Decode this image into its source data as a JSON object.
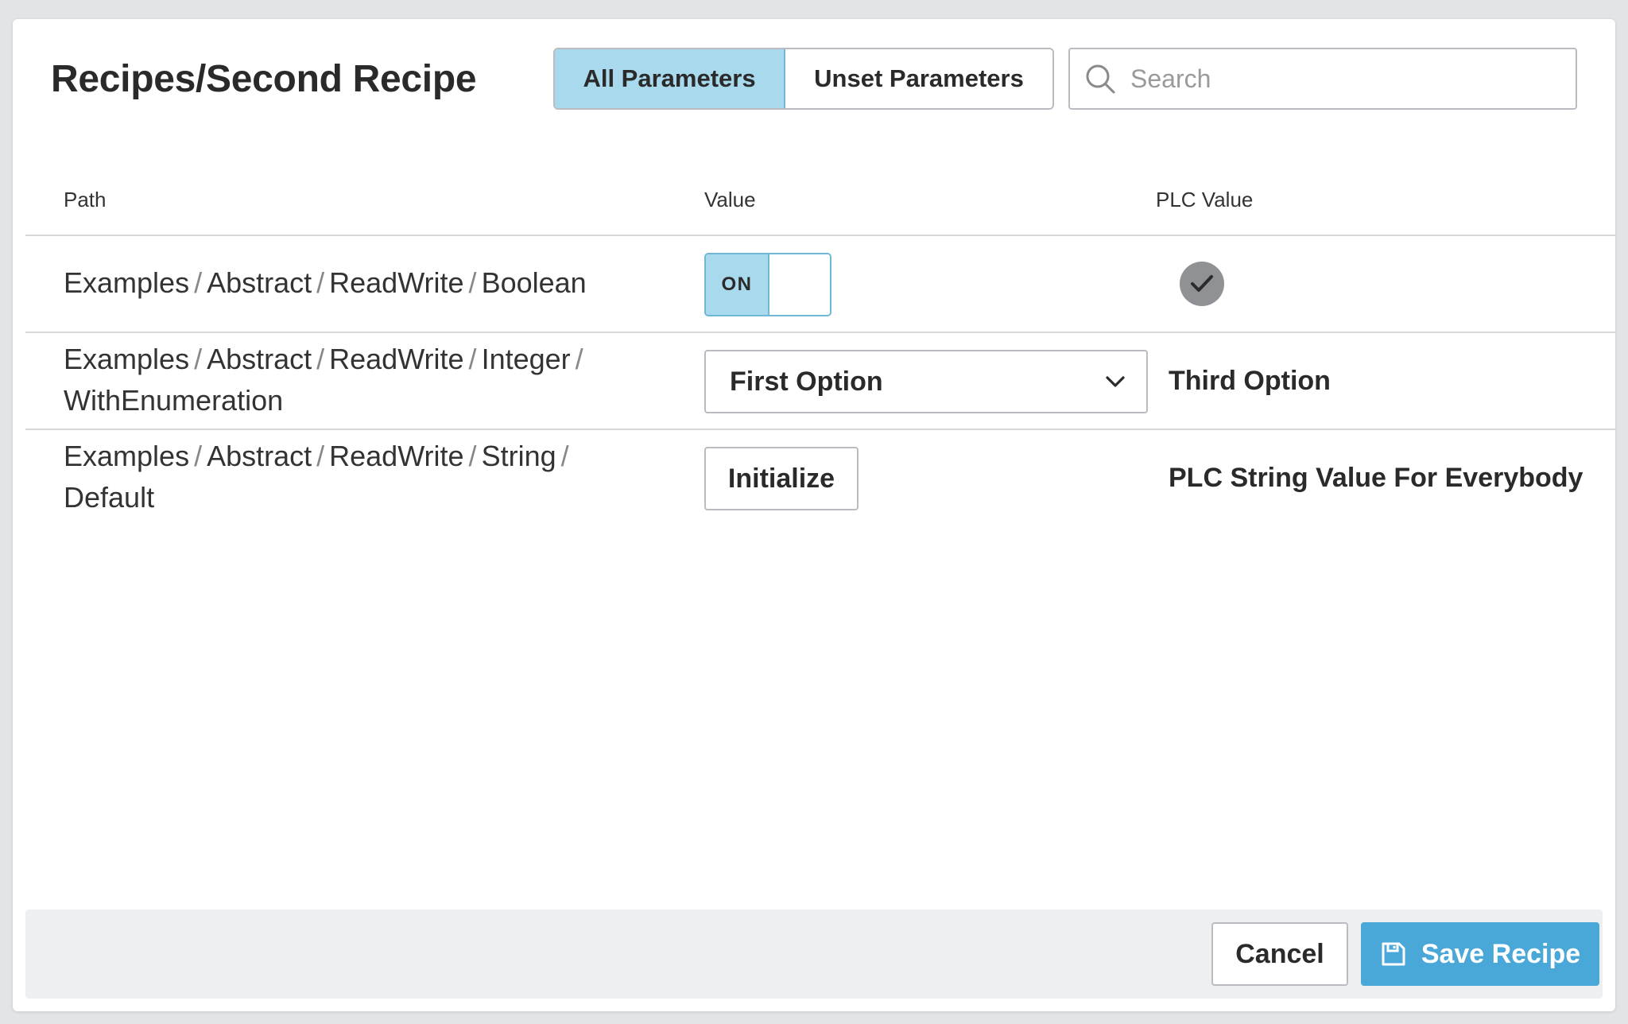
{
  "header": {
    "title": "Recipes/Second Recipe",
    "filter_all_label": "All Parameters",
    "filter_unset_label": "Unset Parameters",
    "active_filter": "All Parameters",
    "search_placeholder": "Search",
    "search_value": ""
  },
  "table": {
    "columns": {
      "path": "Path",
      "value": "Value",
      "plc_value": "PLC Value"
    },
    "path_separator": "/",
    "rows": [
      {
        "path": [
          "Examples",
          "Abstract",
          "ReadWrite",
          "Boolean"
        ],
        "value_type": "toggle",
        "toggle_label": "ON",
        "plc_value_icon": "check-icon"
      },
      {
        "path_line1": [
          "Examples",
          "Abstract",
          "ReadWrite",
          "Integer"
        ],
        "path_line2": "WithEnumeration",
        "value_type": "dropdown",
        "selected_option": "First Option",
        "plc_value": "Third Option"
      },
      {
        "path_line1": [
          "Examples",
          "Abstract",
          "ReadWrite",
          "String"
        ],
        "path_line2": "Default",
        "value_type": "button",
        "button_label": "Initialize",
        "plc_value": "PLC String Value For Everybody"
      }
    ]
  },
  "footer": {
    "cancel_label": "Cancel",
    "save_label": "Save Recipe",
    "save_icon": "save-icon"
  },
  "colors": {
    "accent": "#4aa8d8",
    "selected_fill": "#a8d9ec",
    "selected_border": "#6fb7d6",
    "footer_bg": "#eeeff1"
  }
}
